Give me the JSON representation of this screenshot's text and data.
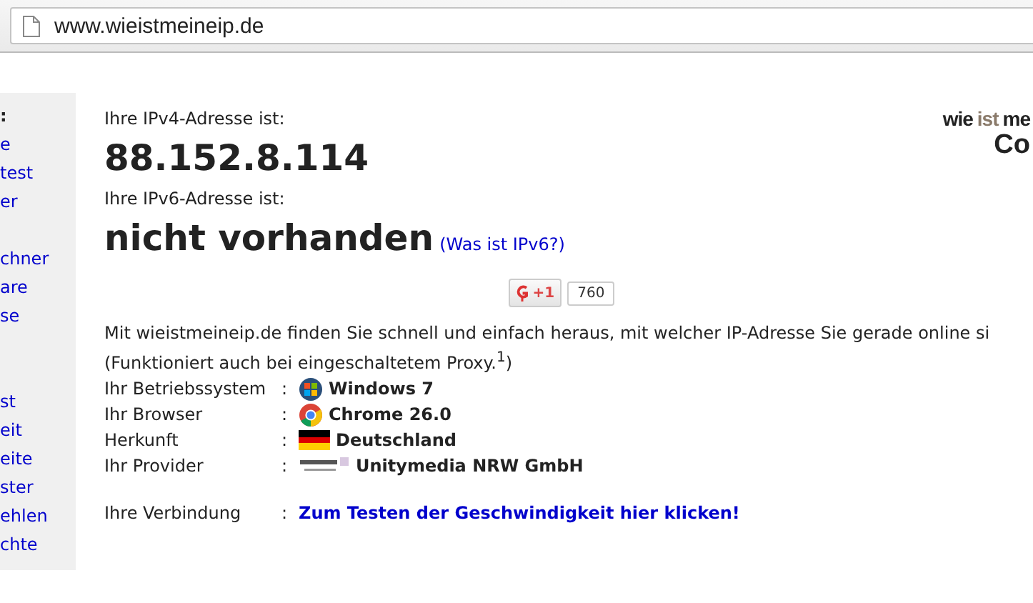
{
  "address_bar": {
    "url": "www.wieistmeineip.de"
  },
  "sidebar": {
    "heading": ":",
    "groups": [
      {
        "items": [
          "e",
          "test",
          "er"
        ]
      },
      {
        "items": [
          "chner",
          "are",
          "se"
        ]
      },
      {
        "items": [
          "st",
          "eit",
          "eite",
          "ster",
          "ehlen",
          "chte"
        ]
      }
    ]
  },
  "logo": {
    "parts": [
      "wie",
      "ist",
      "me"
    ],
    "subline": "Co"
  },
  "ipv4": {
    "label": "Ihre IPv4-Adresse ist:",
    "value": "88.152.8.114"
  },
  "ipv6": {
    "label": "Ihre IPv6-Adresse ist:",
    "value": "nicht vorhanden",
    "link": "(Was ist IPv6?)"
  },
  "plus_one": {
    "label": "+1",
    "count": "760"
  },
  "intro": "Mit wieistmeineip.de finden Sie schnell und einfach heraus, mit welcher IP-Adresse Sie gerade online si",
  "proxy_note": "(Funktioniert auch bei eingeschaltetem Proxy.$^{1}$)",
  "info_rows": [
    {
      "label": "Ihr Betriebssystem",
      "separator": ":",
      "value": "Windows 7",
      "kind": "windows"
    },
    {
      "label": "Ihr Browser",
      "separator": ":",
      "value": "Chrome 26.0",
      "kind": "chrome"
    },
    {
      "label": "Herkunft",
      "separator": ":",
      "value": "Deutschland",
      "kind": "flag"
    },
    {
      "label": "Ihr Provider",
      "separator": ":",
      "value": "Unitymedia NRW GmbH",
      "kind": "provider"
    }
  ],
  "connection": {
    "label": "Ihre Verbindung",
    "separator": ":",
    "link": "Zum Testen der Geschwindigkeit hier klicken!"
  }
}
